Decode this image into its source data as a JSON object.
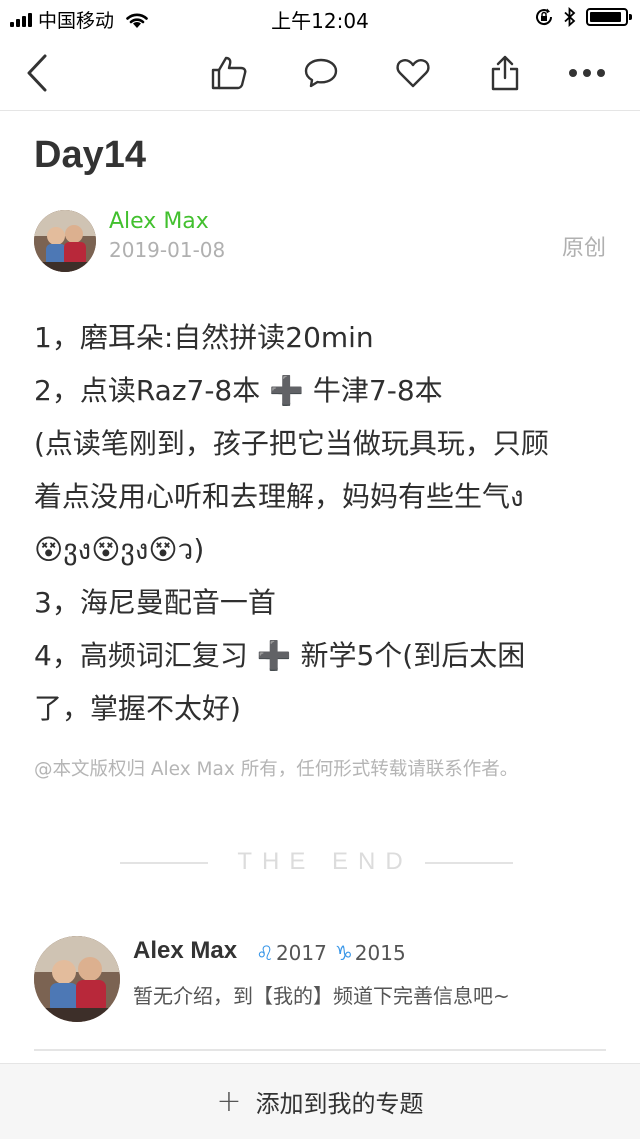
{
  "status_bar": {
    "carrier": "中国移动",
    "time": "上午12:04",
    "battery_level": 0.9
  },
  "nav": {
    "icons": [
      "back-arrow-icon",
      "thumbs-up-icon",
      "comment-icon",
      "heart-icon",
      "share-icon",
      "more-icon"
    ]
  },
  "article": {
    "title": "Day14",
    "author": "Alex Max",
    "date": "2019-01-08",
    "original_label": "原创",
    "lines": [
      "1，磨耳朵:自然拼读20min",
      "2，点读Raz7-8本 ➕ 牛津7-8本",
      "(点读笔刚到，孩子把它当做玩具玩，只顾",
      "着点没用心听和去理解，妈妈有些生气ง",
      "😵ვง😵ვง😵ว)",
      "3，海尼曼配音一首",
      "4，高频词汇复习 ➕ 新学5个(到后太困",
      "了，掌握不太好)"
    ],
    "copyright": "@本文版权归 Alex Max 所有，任何形式转载请联系作者。",
    "end_text": "THE END"
  },
  "author_card": {
    "name": "Alex Max",
    "zodiac1_glyph": "♌",
    "zodiac1_year": "2017",
    "zodiac2_glyph": "♑",
    "zodiac2_year": "2015",
    "bio": "暂无介绍，到【我的】频道下完善信息吧~"
  },
  "bottom_bar": {
    "label": "添加到我的专题"
  },
  "colors": {
    "accent": "#42c02e",
    "zodiac": "#3a97e8",
    "meta": "#b0b0b0"
  }
}
